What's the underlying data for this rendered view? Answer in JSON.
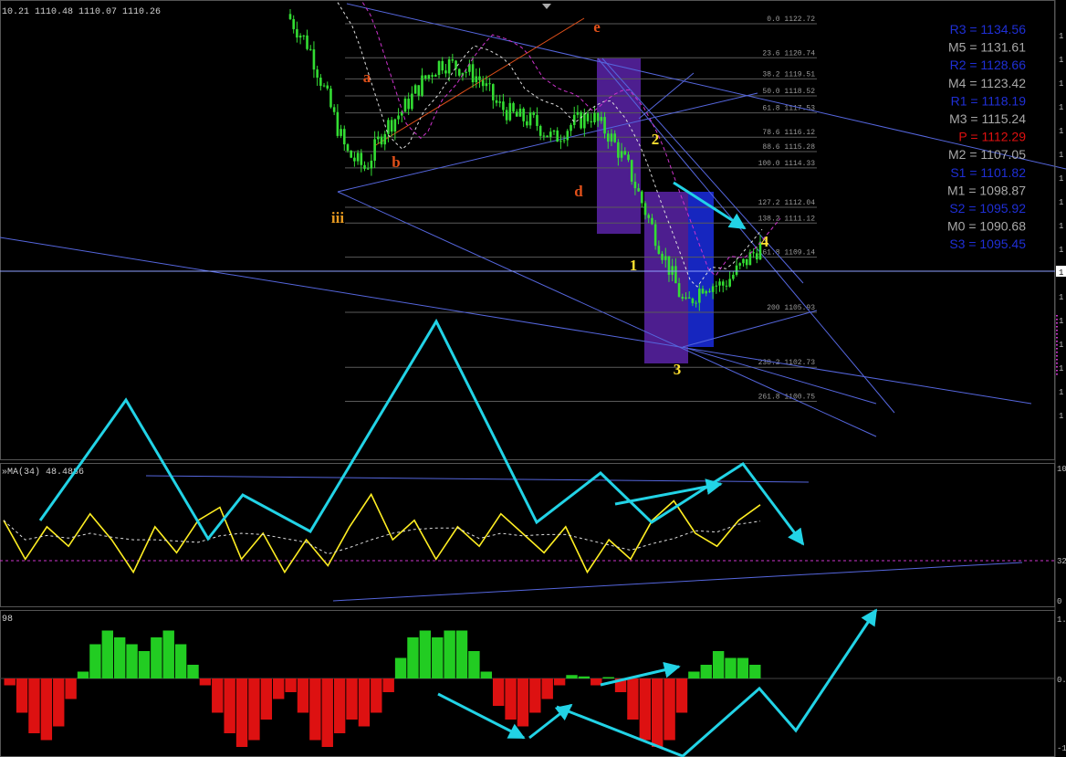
{
  "header": {
    "ohlc_text": "10.21 1110.48 1110.07 1110.26",
    "rsi_label": "»MA(34) 48.4886",
    "hist_label": "98"
  },
  "pivot_levels": [
    {
      "name": "R3",
      "value": "1134.56",
      "color": "#1f2fd6"
    },
    {
      "name": "M5",
      "value": "1131.61",
      "color": "#a8a8a8"
    },
    {
      "name": "R2",
      "value": "1128.66",
      "color": "#1f2fd6"
    },
    {
      "name": "M4",
      "value": "1123.42",
      "color": "#a8a8a8"
    },
    {
      "name": "R1",
      "value": "1118.19",
      "color": "#1f2fd6"
    },
    {
      "name": "M3",
      "value": "1115.24",
      "color": "#a8a8a8"
    },
    {
      "name": "P",
      "value": "1112.29",
      "color": "#e01010"
    },
    {
      "name": "M2",
      "value": "1107.05",
      "color": "#a8a8a8"
    },
    {
      "name": "S1",
      "value": "1101.82",
      "color": "#1f2fd6"
    },
    {
      "name": "M1",
      "value": "1098.87",
      "color": "#a8a8a8"
    },
    {
      "name": "S2",
      "value": "1095.92",
      "color": "#1f2fd6"
    },
    {
      "name": "M0",
      "value": "1090.68",
      "color": "#a8a8a8"
    },
    {
      "name": "S3",
      "value": "1095.45",
      "color": "#1f2fd6"
    }
  ],
  "wave_labels": [
    {
      "text": "a",
      "color": "#e0501a"
    },
    {
      "text": "b",
      "color": "#e0501a"
    },
    {
      "text": "iii",
      "color": "#e89a20"
    },
    {
      "text": "d",
      "color": "#e0501a"
    },
    {
      "text": "e",
      "color": "#e0501a"
    },
    {
      "text": "1",
      "color": "#ffe030"
    },
    {
      "text": "2",
      "color": "#ffe030"
    },
    {
      "text": "3",
      "color": "#ffe030"
    },
    {
      "text": "4",
      "color": "#ffe030"
    }
  ],
  "right_axis": {
    "price_ticks": [
      "1",
      "1",
      "1",
      "1",
      "1",
      "1",
      "1",
      "1",
      "1",
      "1",
      "1",
      "1",
      "1",
      "1",
      "1",
      "1",
      "1"
    ],
    "current_price_box": "1",
    "rsi_ticks": [
      "10",
      "32",
      "0"
    ],
    "hist_ticks": [
      "1.",
      "0.",
      "-1"
    ]
  },
  "colors": {
    "candles": "#33dd33",
    "fib_lines": "#5a5a5a",
    "trend_lines": "#5566dd",
    "arrows": "#22d3e6",
    "rsi_line": "#ffee22",
    "hist_up": "#22cc22",
    "hist_down": "#dd1111",
    "box_purple": "#5a23a8",
    "box_blue": "#1a2de0",
    "ma_dashed": "#dddddd",
    "ma_purple": "#cc33cc"
  },
  "chart_data": [
    {
      "type": "candlestick",
      "fib_levels": [
        {
          "ratio": "0.0",
          "price": 1122.72
        },
        {
          "ratio": "23.6",
          "price": 1120.74
        },
        {
          "ratio": "38.2",
          "price": 1119.51
        },
        {
          "ratio": "50.0",
          "price": 1118.52
        },
        {
          "ratio": "61.8",
          "price": 1117.53
        },
        {
          "ratio": "78.6",
          "price": 1116.12
        },
        {
          "ratio": "88.6",
          "price": 1115.28
        },
        {
          "ratio": "100.0",
          "price": 1114.33
        },
        {
          "ratio": "127.2",
          "price": 1112.04
        },
        {
          "ratio": "138.2",
          "price": 1111.12
        },
        {
          "ratio": "161.8",
          "price": 1109.14
        },
        {
          "ratio": "200",
          "price": 1105.93
        },
        {
          "ratio": "238.2",
          "price": 1102.73
        },
        {
          "ratio": "261.8",
          "price": 1100.75
        }
      ],
      "close_path": [
        1123.0,
        1121.4,
        1118.3,
        1115.2,
        1114.3,
        1116.6,
        1117.7,
        1119.3,
        1120.5,
        1120.2,
        1119.6,
        1118.0,
        1117.3,
        1117.0,
        1116.0,
        1116.9,
        1117.4,
        1116.2,
        1114.3,
        1111.5,
        1108.9,
        1106.2,
        1107.6,
        1107.5,
        1108.6,
        1109.8
      ],
      "last_close": 1110.26
    },
    {
      "type": "line",
      "name": "»MA(34)",
      "ylim": [
        0,
        100
      ],
      "values": [
        60,
        30,
        55,
        40,
        65,
        45,
        20,
        55,
        35,
        60,
        70,
        30,
        50,
        20,
        45,
        25,
        55,
        80,
        45,
        60,
        30,
        55,
        40,
        65,
        50,
        35,
        55,
        20,
        45,
        30,
        60,
        75,
        50,
        40,
        60,
        72
      ],
      "last_value": 48.4886,
      "level_line": 32
    },
    {
      "type": "bar",
      "ylim": [
        -1,
        1
      ],
      "values": [
        -0.1,
        -0.5,
        -0.8,
        -0.9,
        -0.7,
        -0.3,
        0.1,
        0.5,
        0.7,
        0.6,
        0.5,
        0.4,
        0.6,
        0.7,
        0.5,
        0.2,
        -0.1,
        -0.5,
        -0.8,
        -1.0,
        -0.9,
        -0.6,
        -0.3,
        -0.2,
        -0.5,
        -0.9,
        -1.0,
        -0.8,
        -0.6,
        -0.7,
        -0.5,
        -0.2,
        0.3,
        0.6,
        0.7,
        0.6,
        0.7,
        0.7,
        0.4,
        0.1,
        -0.4,
        -0.6,
        -0.7,
        -0.5,
        -0.3,
        -0.1,
        0.05,
        0.03,
        -0.1,
        0.02,
        -0.2,
        -0.6,
        -0.9,
        -1.0,
        -0.9,
        -0.5,
        0.1,
        0.2,
        0.4,
        0.3,
        0.3,
        0.2
      ]
    }
  ]
}
